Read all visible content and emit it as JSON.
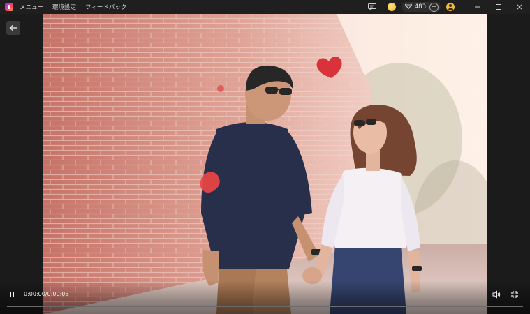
{
  "menu": {
    "items": [
      "メニュー",
      "環境設定",
      "フィードバック"
    ]
  },
  "account": {
    "gem_count": "483",
    "plus_label": "+"
  },
  "icons": {
    "chat": "chat-icon",
    "coin": "coin-icon",
    "gem": "gem-icon",
    "avatar": "avatar-icon",
    "minimize": "minimize-icon",
    "maximize": "maximize-icon",
    "close": "close-icon",
    "back": "back-arrow-icon",
    "pause": "pause-icon",
    "volume": "volume-icon",
    "fullscreen": "fullscreen-icon"
  },
  "player": {
    "time": "0:00:00/0:00:05",
    "progress_fraction": 0.0
  },
  "colors": {
    "background": "#1b1b1b",
    "titlebar": "#1f1f1f",
    "coin": "#f2b21a",
    "avatar": "#f0b93a",
    "heart": "#d8262e"
  }
}
